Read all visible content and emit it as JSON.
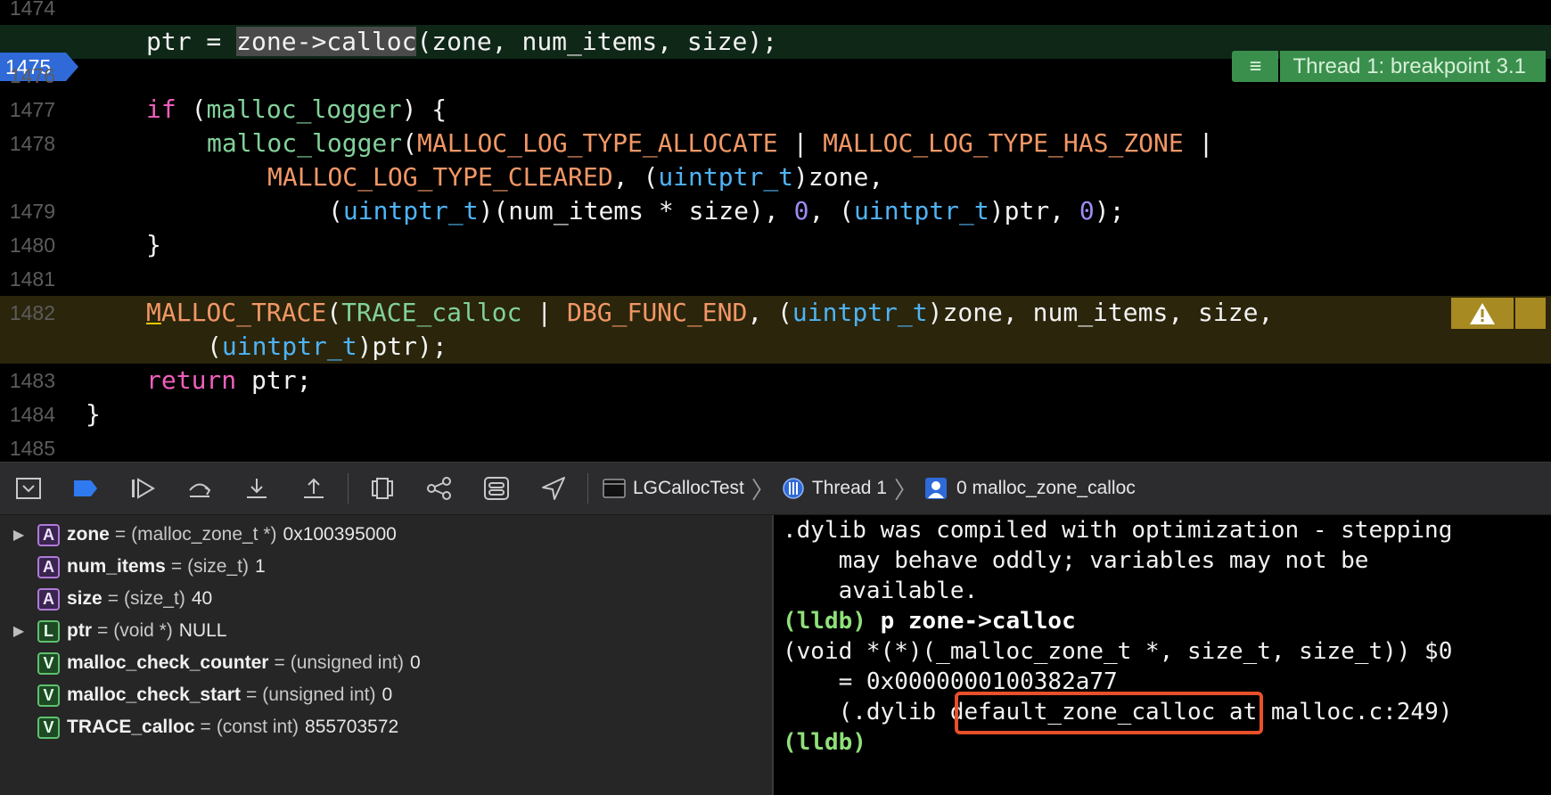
{
  "editor": {
    "lines": [
      {
        "num": "1474"
      },
      {
        "num": "1475",
        "current": true
      },
      {
        "num": "1476"
      },
      {
        "num": "1477"
      },
      {
        "num": "1478"
      },
      {
        "num": "1479"
      },
      {
        "num": "1480"
      },
      {
        "num": "1481"
      },
      {
        "num": "1482"
      },
      {
        "num": "1483"
      },
      {
        "num": "1484"
      },
      {
        "num": "1485"
      }
    ],
    "code": {
      "l1475_a": "ptr = ",
      "l1475_sel": "zone->calloc",
      "l1475_b": "(zone, num_items, size);",
      "l1477_kw": "if",
      "l1477_a": " (",
      "l1477_fn": "malloc_logger",
      "l1477_b": ") {",
      "l1478_fn": "malloc_logger",
      "l1478_a": "(",
      "l1478_m1": "MALLOC_LOG_TYPE_ALLOCATE",
      "l1478_b": " | ",
      "l1478_m2": "MALLOC_LOG_TYPE_HAS_ZONE",
      "l1478_c": " |",
      "l1478w_m": "MALLOC_LOG_TYPE_CLEARED",
      "l1478w_a": ", (",
      "l1478w_t": "uintptr_t",
      "l1478w_b": ")zone,",
      "l1479_a": "(",
      "l1479_t1": "uintptr_t",
      "l1479_b": ")(num_items * size), ",
      "l1479_n1": "0",
      "l1479_c": ", (",
      "l1479_t2": "uintptr_t",
      "l1479_d": ")ptr, ",
      "l1479_n2": "0",
      "l1479_e": ");",
      "l1480": "}",
      "l1482_u": "M",
      "l1482_m1": "ALLOC_TRACE",
      "l1482_a": "(",
      "l1482_m2": "TRACE_calloc",
      "l1482_b": " | ",
      "l1482_m3": "DBG_FUNC_END",
      "l1482_c": ", (",
      "l1482_t": "uintptr_t",
      "l1482_d": ")zone, num_items, size,",
      "l1482w_a": "(",
      "l1482w_t": "uintptr_t",
      "l1482w_b": ")ptr);",
      "l1483_kw": "return",
      "l1483_a": " ptr;",
      "l1484": "}"
    },
    "thread_badge": "Thread 1: breakpoint 3.1",
    "menu_glyph": "≡"
  },
  "debug_bar": {
    "process": "LGCallocTest",
    "thread": "Thread 1",
    "frame": "0 malloc_zone_calloc"
  },
  "variables": [
    {
      "kind": "A",
      "name": "zone",
      "type": "(malloc_zone_t *)",
      "value": "0x100395000",
      "expandable": true
    },
    {
      "kind": "A",
      "name": "num_items",
      "type": "(size_t)",
      "value": "1",
      "expandable": false
    },
    {
      "kind": "A",
      "name": "size",
      "type": "(size_t)",
      "value": "40",
      "expandable": false
    },
    {
      "kind": "L",
      "name": "ptr",
      "type": "(void *)",
      "value": "NULL",
      "expandable": true
    },
    {
      "kind": "V",
      "name": "malloc_check_counter",
      "type": "(unsigned int)",
      "value": "0",
      "expandable": false
    },
    {
      "kind": "V",
      "name": "malloc_check_start",
      "type": "(unsigned int)",
      "value": "0",
      "expandable": false
    },
    {
      "kind": "V",
      "name": "TRACE_calloc",
      "type": "(const int)",
      "value": "855703572",
      "expandable": false
    }
  ],
  "console": {
    "l1": ".dylib was compiled with optimization - stepping",
    "l2": "    may behave oddly; variables may not be",
    "l3": "    available.",
    "prompt": "(lldb)",
    "cmd": " p zone->calloc",
    "l5": "(void *(*)(_malloc_zone_t *, size_t, size_t)) $0",
    "l6": "    = 0x0000000100382a77",
    "l7a": "    (.dylib ",
    "l7b": "default_zone_calloc",
    "l7c": " at malloc.c:249)",
    "prompt2": "(lldb)"
  },
  "colors": {
    "current_line": "#0e2717",
    "warning_line": "#2a250b",
    "breakpoint": "#2f6ad8",
    "thread_badge": "#3b8f4d",
    "callout": "#e8502a"
  }
}
